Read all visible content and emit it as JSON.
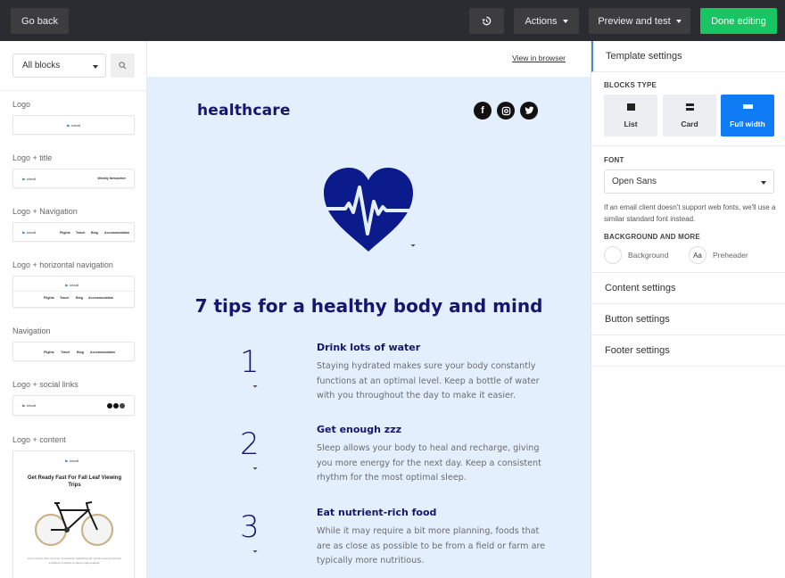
{
  "topbar": {
    "go_back": "Go back",
    "history_icon": "history-icon",
    "actions": "Actions",
    "preview_and_test": "Preview and test",
    "done_editing": "Done editing",
    "colors": {
      "bar": "#2a2c31",
      "button": "#3d3d3f",
      "done": "#19c463"
    }
  },
  "sidebar": {
    "filter_select": "All blocks",
    "search_icon": "search-icon",
    "blocks": [
      {
        "label": "Logo",
        "preview": {
          "logo": "simail"
        }
      },
      {
        "label": "Logo + title",
        "preview": {
          "logo": "simail",
          "title": "Weekly Newsletter"
        }
      },
      {
        "label": "Logo + Navigation",
        "preview": {
          "logo": "simail",
          "nav": [
            "Flights",
            "Travel",
            "Blog",
            "Accommodation"
          ]
        }
      },
      {
        "label": "Logo + horizontal navigation",
        "preview": {
          "logo": "simail",
          "nav": [
            "Flights",
            "Travel",
            "Blog",
            "Accommodation"
          ]
        }
      },
      {
        "label": "Navigation",
        "preview": {
          "nav": [
            "Flights",
            "Travel",
            "Blog",
            "Accommodation"
          ]
        }
      },
      {
        "label": "Logo + social links",
        "preview": {
          "logo": "simail",
          "social": [
            "facebook",
            "instagram",
            "twitter"
          ]
        }
      },
      {
        "label": "Logo + content",
        "preview": {
          "logo": "simail",
          "title": "Get Ready Fast For Fall Leaf Viewing Trips",
          "image": "bicycle",
          "body": "Lorem ipsum dolor sit amet, consectetur adipiscing elit, sed do eiusmod tempor incididunt ut labore et dolore magna aliqua."
        }
      }
    ]
  },
  "email": {
    "view_in_browser": "View in browser",
    "brand": "healthcare",
    "social_icons": [
      "facebook",
      "instagram",
      "twitter"
    ],
    "hero_icon": "heart-pulse-icon",
    "headline": "7 tips for a healthy body and mind",
    "tips": [
      {
        "number": "1",
        "title": "Drink lots of water",
        "body": "Staying hydrated makes sure your body constantly functions at an optimal level. Keep a bottle of water with you throughout the day to make it easier."
      },
      {
        "number": "2",
        "title": "Get enough zzz",
        "body": "Sleep allows your body to heal and recharge, giving you more energy for the next day. Keep a consistent rhythm for the most optimal sleep."
      },
      {
        "number": "3",
        "title": "Eat nutrient-rich food",
        "body": "While it may require a bit more planning, foods that are as close as possible to be from a field or farm are typically more nutritious."
      }
    ],
    "colors": {
      "background": "#e3effc",
      "primary": "#15166d",
      "body_text": "#6b6b70"
    }
  },
  "settings": {
    "template_settings": "Template settings",
    "blocks_type_label": "BLOCKS TYPE",
    "blocks_types": [
      {
        "label": "List",
        "active": false
      },
      {
        "label": "Card",
        "active": false
      },
      {
        "label": "Full width",
        "active": true
      }
    ],
    "font_label": "FONT",
    "font_value": "Open Sans",
    "font_hint": "If an email client doesn't support web fonts, we'll use a similar standard font instead.",
    "background_label": "BACKGROUND AND MORE",
    "background": "Background",
    "preheader_glyph": "Aa",
    "preheader": "Preheader",
    "content_settings": "Content settings",
    "button_settings": "Button settings",
    "footer_settings": "Footer settings",
    "accent": "#0f7bf5"
  }
}
